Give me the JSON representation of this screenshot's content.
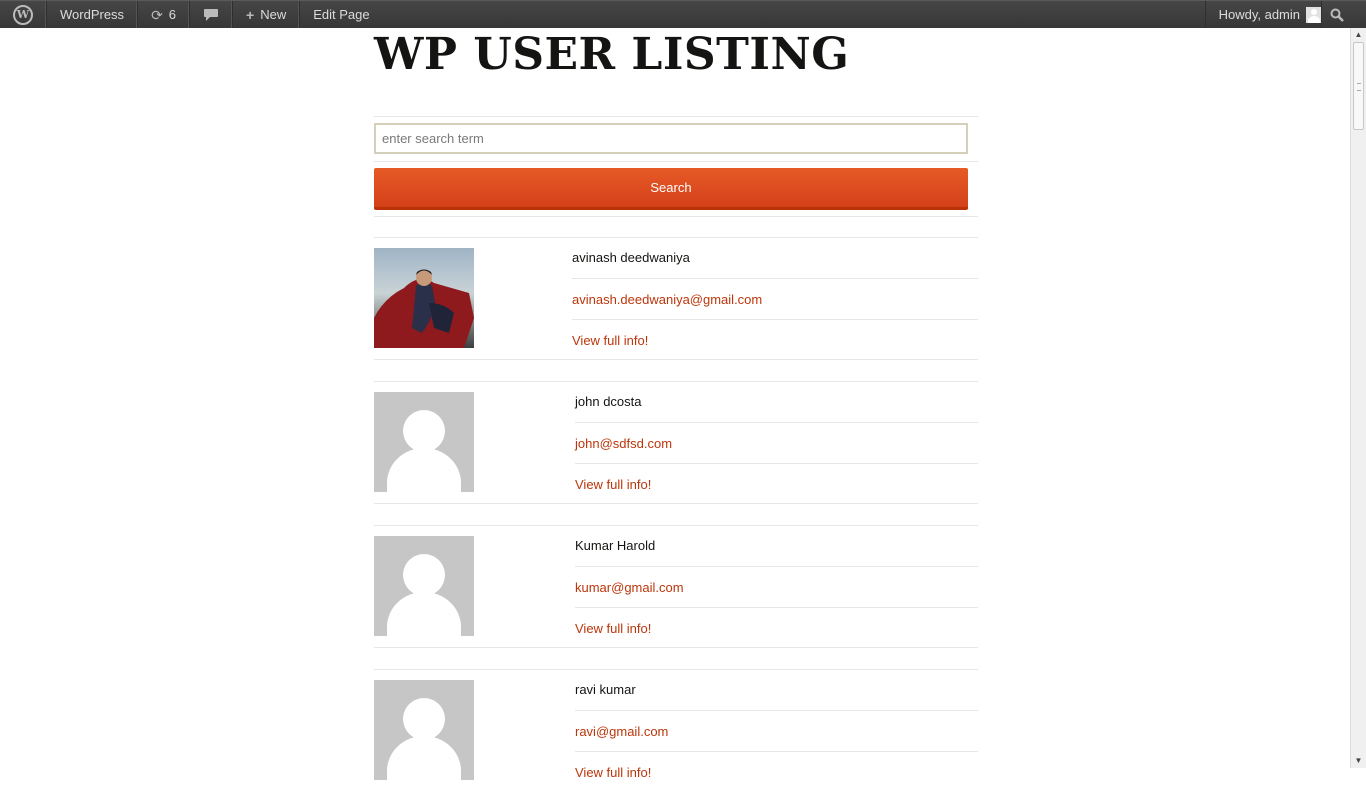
{
  "adminbar": {
    "site_name": "WordPress",
    "updates_count": "6",
    "new_label": "New",
    "edit_page_label": "Edit Page",
    "greeting": "Howdy, admin"
  },
  "page": {
    "title": "WP USER LISTING"
  },
  "search": {
    "placeholder": "enter search term",
    "value": "",
    "button_label": "Search"
  },
  "users": [
    {
      "name": "avinash deedwaniya",
      "email": "avinash.deedwaniya@gmail.com",
      "view_label": "View full info!",
      "avatar": "photo"
    },
    {
      "name": "john dcosta",
      "email": "john@sdfsd.com",
      "view_label": "View full info!",
      "avatar": "default"
    },
    {
      "name": "Kumar Harold",
      "email": "kumar@gmail.com",
      "view_label": "View full info!",
      "avatar": "default"
    },
    {
      "name": "ravi kumar",
      "email": "ravi@gmail.com",
      "view_label": "View full info!",
      "avatar": "default"
    }
  ],
  "colors": {
    "accent": "#bc360a",
    "button": "#e05d22",
    "adminbar": "#464646"
  }
}
